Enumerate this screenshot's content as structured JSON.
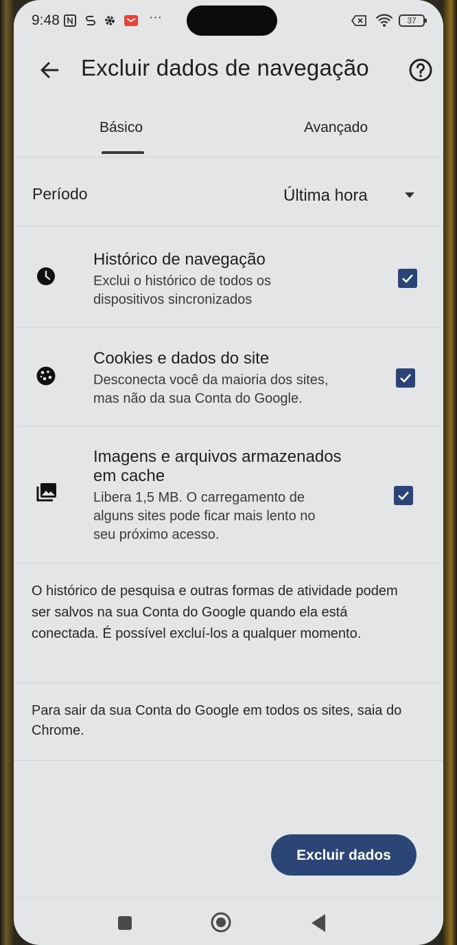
{
  "status_bar": {
    "time": "9:48",
    "battery": "37",
    "icons": [
      "nfc-icon",
      "sync-icon",
      "settings-icon",
      "mail-icon",
      "more-icon",
      "sim-icon",
      "wifi-icon",
      "battery-icon"
    ],
    "more_glyph": "···"
  },
  "app_bar": {
    "title": "Excluir dados de navegação",
    "back_icon": "back-arrow-icon",
    "help_icon": "help-icon"
  },
  "tabs": [
    {
      "label": "Básico",
      "selected": true
    },
    {
      "label": "Avançado",
      "selected": false
    }
  ],
  "period": {
    "label": "Período",
    "value": "Última hora"
  },
  "options": [
    {
      "icon": "clock-icon",
      "title": "Histórico de navegação",
      "description_lines": [
        "Exclui o histórico de todos os",
        "dispositivos sincronizados"
      ],
      "checked": true
    },
    {
      "icon": "cookie-icon",
      "title": "Cookies e dados do site",
      "description_lines": [
        "Desconecta você da maioria dos sites,",
        "mas não da sua Conta do Google."
      ],
      "checked": true
    },
    {
      "icon": "image-icon",
      "title_lines": [
        "Imagens e arquivos armazenados",
        "em cache"
      ],
      "description_lines": [
        "Libera 1,5 MB. O carregamento de",
        "alguns sites pode ficar mais lento no",
        "seu próximo acesso."
      ],
      "checked": true
    }
  ],
  "info": {
    "search_history": "O histórico de pesquisa e outras formas de atividade podem ser salvos na sua Conta do Google quando ela está conectada. É possível excluí-los a qualquer momento.",
    "sign_out": "Para sair da sua Conta do Google em todos os sites, saia do Chrome."
  },
  "actions": {
    "delete_label": "Excluir dados"
  },
  "colors": {
    "accent": "#2b4676",
    "background": "#e4e5e6"
  }
}
